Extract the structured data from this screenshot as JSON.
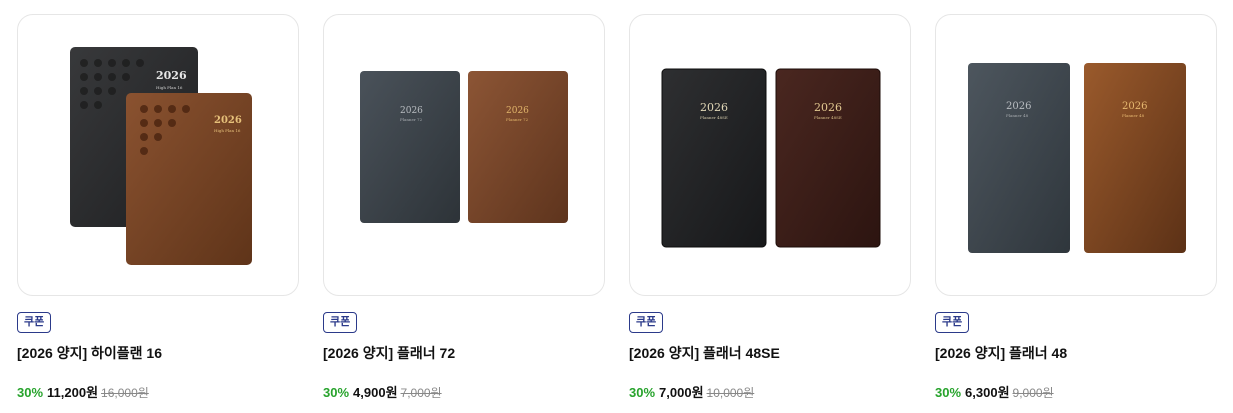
{
  "products": [
    {
      "badge": "쿠폰",
      "title": "[2026 양지] 하이플랜 16",
      "discount": "30%",
      "price": "11,200원",
      "original_price": "16,000원",
      "cover_texts": [
        "2026",
        "High Plan 16",
        "2026",
        "High Plan 16"
      ]
    },
    {
      "badge": "쿠폰",
      "title": "[2026 양지] 플래너 72",
      "discount": "30%",
      "price": "4,900원",
      "original_price": "7,000원",
      "cover_texts": [
        "2026",
        "Planner 72",
        "2026",
        "Planner 72"
      ]
    },
    {
      "badge": "쿠폰",
      "title": "[2026 양지] 플래너 48SE",
      "discount": "30%",
      "price": "7,000원",
      "original_price": "10,000원",
      "cover_texts": [
        "2026",
        "Planner 48SE",
        "2026",
        "Planner 48SE"
      ]
    },
    {
      "badge": "쿠폰",
      "title": "[2026 양지] 플래너 48",
      "discount": "30%",
      "price": "6,300원",
      "original_price": "9,000원",
      "cover_texts": [
        "2026",
        "Planner 48",
        "2026",
        "Planner 48"
      ]
    }
  ],
  "colors": {
    "discount": "#27a32c",
    "badge": "#2b3a8a",
    "black_cover": "#2a2b2d",
    "slate_cover": "#3b4248",
    "brown_cover": "#7a4423",
    "dark_brown_cover": "#3c1e17"
  }
}
